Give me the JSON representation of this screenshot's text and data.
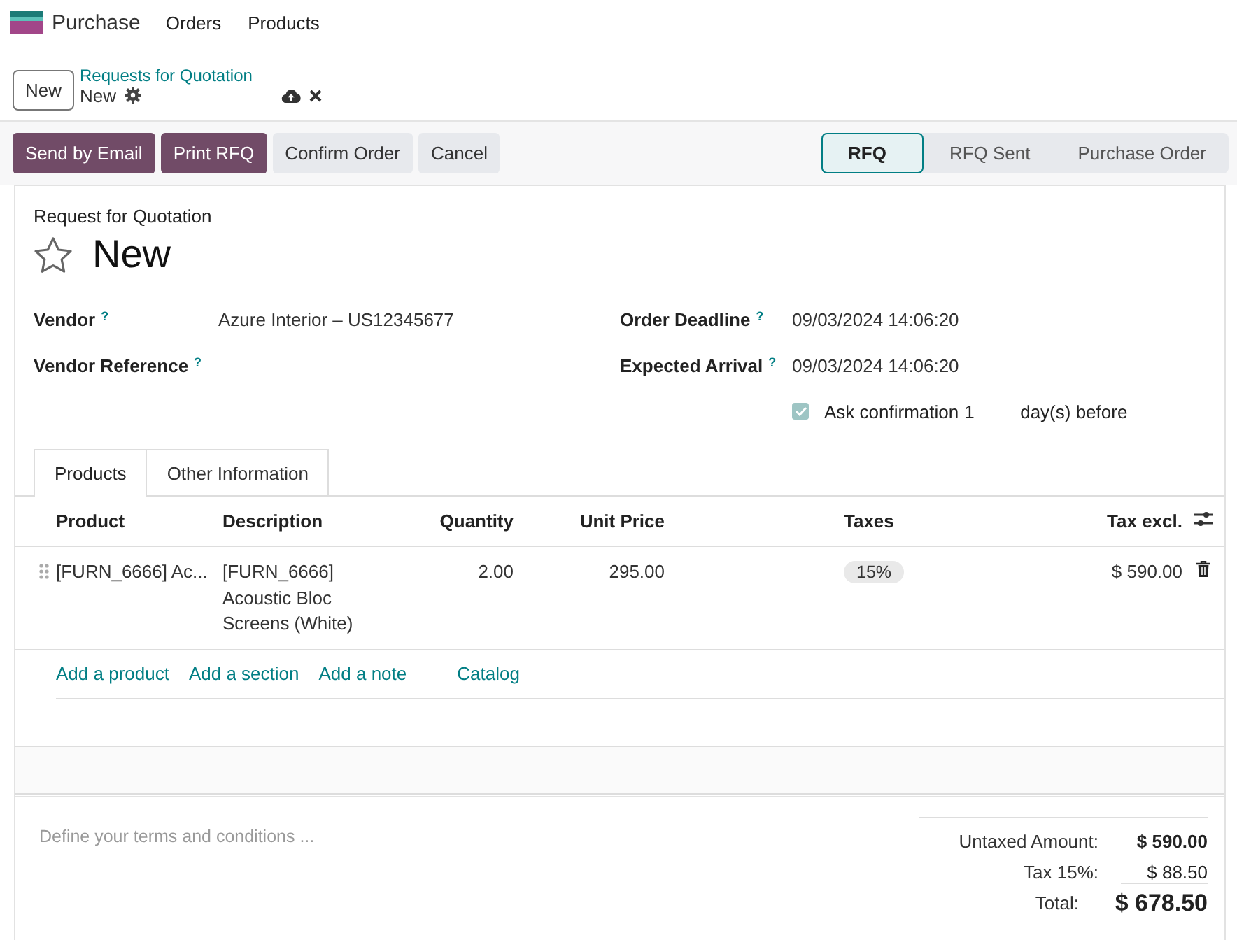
{
  "app": {
    "name": "Purchase",
    "menu": [
      "Orders",
      "Products"
    ]
  },
  "control_panel": {
    "new_button": "New",
    "breadcrumb_parent": "Requests for Quotation",
    "breadcrumb_current": "New"
  },
  "actions": [
    {
      "label": "Send by Email",
      "kind": "primary"
    },
    {
      "label": "Print RFQ",
      "kind": "primary"
    },
    {
      "label": "Confirm Order",
      "kind": "secondary"
    },
    {
      "label": "Cancel",
      "kind": "secondary"
    }
  ],
  "stages": [
    {
      "label": "RFQ",
      "selected": true
    },
    {
      "label": "RFQ Sent",
      "selected": false
    },
    {
      "label": "Purchase Order",
      "selected": false
    }
  ],
  "form": {
    "subtitle": "Request for Quotation",
    "name": "New",
    "starred": false,
    "left_fields": [
      {
        "label": "Vendor",
        "help": "?",
        "value": "Azure Interior – US12345677"
      },
      {
        "label": "Vendor Reference",
        "help": "?"
      }
    ],
    "right_fields": [
      {
        "label": "Order Deadline",
        "help": "?",
        "value": "09/03/2024 14:06:20"
      },
      {
        "label": "Expected Arrival",
        "help": "?",
        "value": "09/03/2024 14:06:20"
      }
    ],
    "ask_confirmation": {
      "label": "Ask confirmation",
      "checked": true,
      "days": "1",
      "suffix": "day(s) before"
    }
  },
  "tabs": [
    {
      "label": "Products",
      "selected": true
    },
    {
      "label": "Other Information",
      "selected": false
    }
  ],
  "table": {
    "columns": [
      "Product",
      "Description",
      "Quantity",
      "Unit Price",
      "Taxes",
      "Tax excl."
    ],
    "rows": [
      {
        "product": "[FURN_6666] Ac...",
        "description": [
          "[FURN_6666]",
          "Acoustic Bloc",
          "Screens (White)"
        ],
        "quantity": "2.00",
        "unit_price": "295.00",
        "taxes": "15%",
        "subtotal": "$ 590.00"
      }
    ],
    "add_links": [
      "Add a product",
      "Add a section",
      "Add a note",
      "Catalog"
    ]
  },
  "terms_placeholder": "Define your terms and conditions ...",
  "totals": [
    {
      "label": "Untaxed Amount:",
      "value": "$ 590.00",
      "kind": "subtotal"
    },
    {
      "label": "Tax 15%:",
      "value": "$ 88.50",
      "kind": "tax"
    },
    {
      "label": "Total:",
      "value": "$ 678.50",
      "kind": "total"
    }
  ]
}
